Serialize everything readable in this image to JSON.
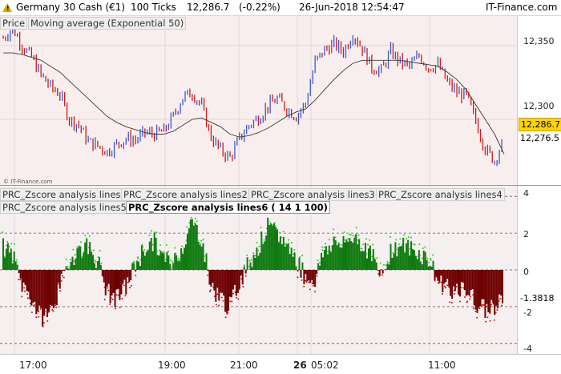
{
  "header": {
    "instrument": "Germany 30 Cash (€1)",
    "ticks": "100 Ticks",
    "last_price": "12,286.7",
    "change": "(-0.22%)",
    "datetime": "26-Jun-2018 12:54:47",
    "brand": "IT-Finance.com"
  },
  "price_panel": {
    "legends": [
      "Price",
      "Moving average (Exponential 50)"
    ],
    "copyright": "© IT-Finance.com",
    "axis_ticks": [
      12350,
      12300
    ],
    "axis_tick_labels": [
      "12,350",
      "12,300"
    ],
    "current_price_label": "12,286.7",
    "ema_label": "12,276.5",
    "colors": {
      "up": "#3a5bd0",
      "down": "#c81c1c",
      "ema": "#3a3a3a",
      "current": "#ffd400"
    }
  },
  "osc_panel": {
    "legends_row1": [
      "PRC_Zscore analysis lines",
      "PRC_Zscore analysis lines2",
      "PRC_Zscore analysis lines3",
      "PRC_Zscore analysis lines4"
    ],
    "legends_row2": [
      "PRC_Zscore analysis lines5"
    ],
    "active_legend": "PRC_Zscore analysis lines6  ( 14 1 100)",
    "axis_ticks": [
      4,
      2,
      0,
      -2,
      -4
    ],
    "axis_tick_labels": [
      "4",
      "2",
      "0",
      "-2",
      "-4"
    ],
    "current_value_label": "-1.3818",
    "colors": {
      "positive": "#0f7a0f",
      "positive_dots": "#22cc22",
      "negative": "#6e0000",
      "negative_dots": "#d01010",
      "levels": "#555555"
    }
  },
  "time_axis": {
    "labels": [
      "17:00",
      "19:00",
      "21:00",
      "26",
      "05:02",
      "11:00"
    ]
  },
  "chart_data": [
    {
      "type": "line",
      "title": "",
      "series": [
        {
          "name": "Price",
          "values": [
            12355,
            12362,
            12350,
            12342,
            12330,
            12322,
            12317,
            12300,
            12296,
            12285,
            12282,
            12278,
            12283,
            12287,
            12286,
            12291,
            12290,
            12292,
            12302,
            12315,
            12318,
            12309,
            12288,
            12279,
            12274,
            12287,
            12296,
            12301,
            12309,
            12314,
            12307,
            12302,
            12311,
            12339,
            12347,
            12351,
            12346,
            12358,
            12348,
            12335,
            12333,
            12346,
            12339,
            12336,
            12343,
            12335,
            12337,
            12325,
            12318,
            12316,
            12299,
            12280,
            12272,
            12286.7
          ]
        },
        {
          "name": "Moving average (Exponential 50)",
          "values": [
            12345,
            12345,
            12344,
            12342,
            12340,
            12336,
            12332,
            12326,
            12320,
            12314,
            12308,
            12302,
            12298,
            12295,
            12293,
            12291,
            12290,
            12290,
            12292,
            12296,
            12300,
            12301,
            12298,
            12295,
            12290,
            12288,
            12289,
            12291,
            12294,
            12298,
            12302,
            12305,
            12307,
            12313,
            12320,
            12327,
            12333,
            12338,
            12340,
            12340,
            12340,
            12340,
            12340,
            12339,
            12338,
            12337,
            12336,
            12332,
            12327,
            12320,
            12310,
            12300,
            12290,
            12276.5
          ]
        }
      ],
      "ylim": [
        12255,
        12370
      ]
    },
    {
      "type": "area",
      "title": "",
      "series": [
        {
          "name": "PRC_Zscore analysis lines6",
          "values": [
            1.2,
            0.8,
            -0.8,
            -1.5,
            -2.6,
            -2.2,
            -1.0,
            0.5,
            1.1,
            1.3,
            0.5,
            -1.2,
            -1.6,
            -0.9,
            0.3,
            1.2,
            1.5,
            0.6,
            0.4,
            1.3,
            2.6,
            1.7,
            -0.9,
            -1.5,
            -2.0,
            -0.6,
            0.4,
            1.2,
            2.3,
            1.9,
            1.4,
            0.6,
            -0.4,
            -0.5,
            1.1,
            1.5,
            1.3,
            1.9,
            1.4,
            0.9,
            -0.5,
            1.1,
            1.3,
            1.2,
            0.9,
            0.6,
            -0.6,
            -0.8,
            -1.3,
            -1.0,
            -1.8,
            -2.2,
            -1.9,
            -1.3818
          ]
        }
      ],
      "levels": [
        4,
        2,
        0,
        -2,
        -4
      ],
      "ylim": [
        -4.4,
        4.4
      ]
    }
  ]
}
